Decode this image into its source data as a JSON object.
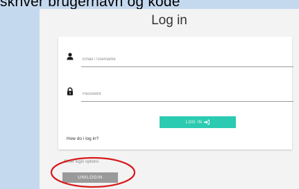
{
  "caption": "skriver brugernavn og kode",
  "page": {
    "title": "Log in"
  },
  "login_form": {
    "email_placeholder": "Email / Username",
    "password_placeholder": "Password",
    "login_button_label": "LOG IN",
    "help_link": "How do i log in?"
  },
  "other_login": {
    "label": "Other login options",
    "unilogin_label": "UNILOGIN"
  },
  "icons": {
    "user": "user-icon",
    "lock": "lock-icon",
    "login_arrow": "sign-in-icon"
  },
  "colors": {
    "background": "#c5d9ee",
    "page": "#f3f3f3",
    "card": "#ffffff",
    "accent": "#2bcbb1",
    "unilogin": "#9a9a9a",
    "highlight": "#d7191c"
  }
}
